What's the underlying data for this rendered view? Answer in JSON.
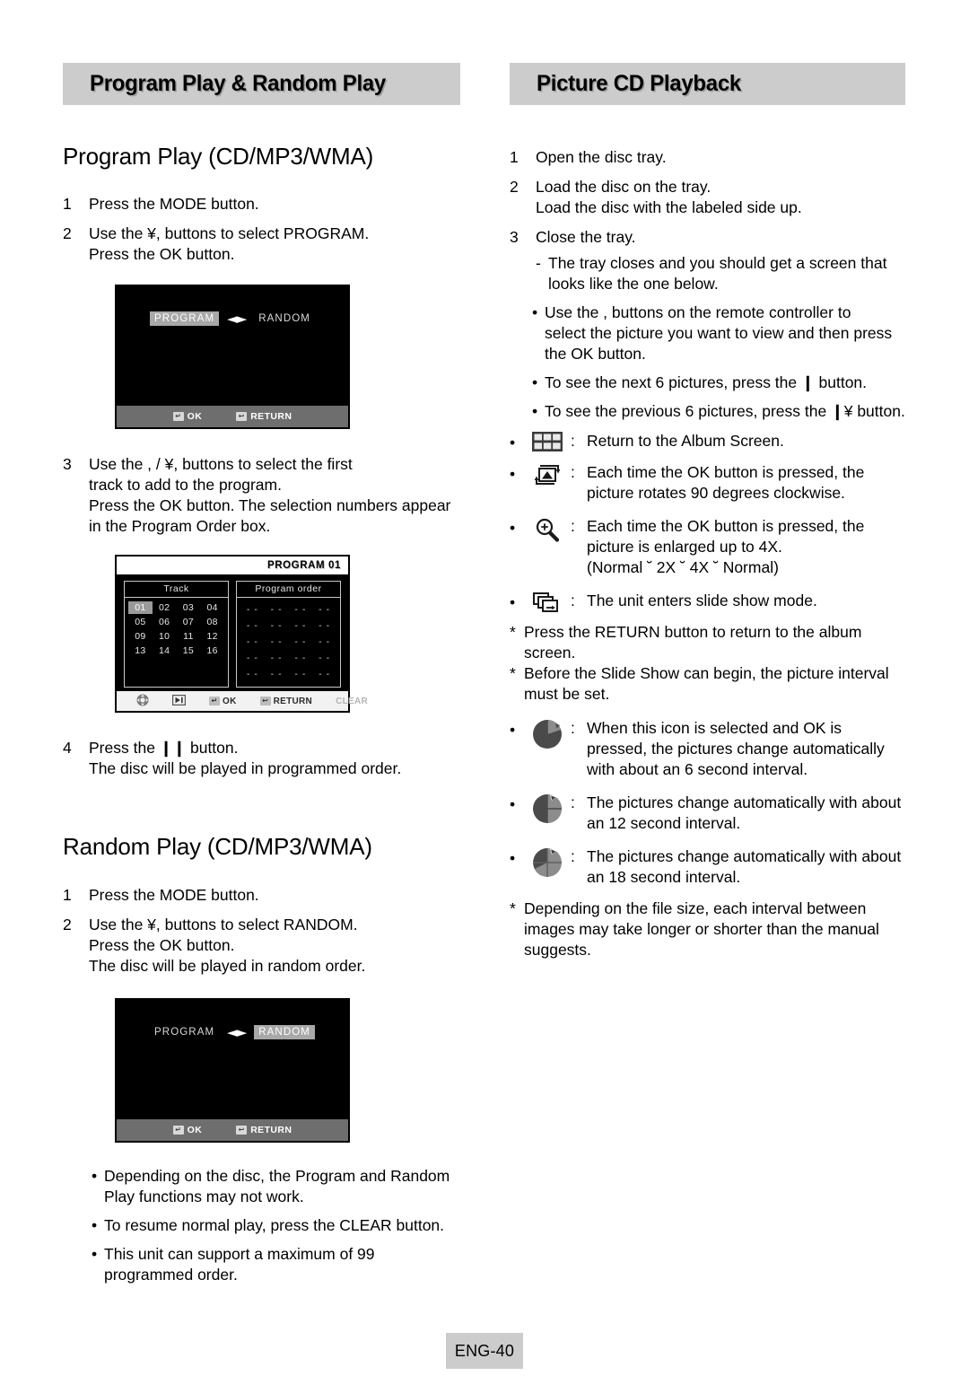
{
  "left": {
    "section_title": "Program Play & Random Play",
    "program": {
      "heading": "Program Play (CD/MP3/WMA)",
      "steps": [
        {
          "num": "1",
          "lines": [
            "Press the MODE button."
          ]
        },
        {
          "num": "2",
          "lines": [
            "Use the ¥,    buttons to select PROGRAM.",
            "Press the OK button."
          ]
        }
      ],
      "steps2": [
        {
          "num": "3",
          "lines": [
            "Use the    ,     / ¥,     buttons to select the first",
            "track to add to the program.",
            "Press the OK button. The selection numbers appear",
            "in the Program Order box."
          ]
        }
      ],
      "steps3": [
        {
          "num": "4",
          "lines": [
            "Press the     ❙❙ button.",
            "The disc will be played in programmed order."
          ]
        }
      ]
    },
    "osd1": {
      "program_label": "PROGRAM",
      "random_label": "RANDOM",
      "selected": "PROGRAM",
      "ok_label": "OK",
      "return_label": "RETURN",
      "ok_keycap": "↵",
      "return_keycap": "↩"
    },
    "prog_table": {
      "title": "PROGRAM 01",
      "track_header": "Track",
      "order_header": "Program  order",
      "tracks": [
        "01",
        "02",
        "03",
        "04",
        "05",
        "06",
        "07",
        "08",
        "09",
        "10",
        "11",
        "12",
        "13",
        "14",
        "15",
        "16"
      ],
      "selected_track": "01",
      "order_placeholder": "- -",
      "order_rows": 5,
      "order_cols": 4,
      "footer": {
        "ok_label": "OK",
        "return_label": "RETURN",
        "clear_label": "CLEAR",
        "dpad_icon": "dpad-icon",
        "play_icon": "play-icon",
        "ok_keycap": "↵",
        "return_keycap": "↩"
      }
    },
    "random": {
      "heading": "Random Play (CD/MP3/WMA)",
      "steps": [
        {
          "num": "1",
          "lines": [
            "Press the MODE button."
          ]
        },
        {
          "num": "2",
          "lines": [
            "Use the ¥,    buttons to select RANDOM.",
            "Press the OK button.",
            " The disc will be played in random order."
          ]
        }
      ]
    },
    "osd2": {
      "program_label": "PROGRAM",
      "random_label": "RANDOM",
      "selected": "RANDOM",
      "ok_label": "OK",
      "return_label": "RETURN",
      "ok_keycap": "↵",
      "return_keycap": "↩"
    },
    "notes": [
      [
        "Depending on the disc, the Program and Random",
        "Play functions may not work."
      ],
      [
        "To resume normal play, press the CLEAR button."
      ],
      [
        "This unit can support a maximum of 99",
        "programmed order."
      ]
    ]
  },
  "right": {
    "section_title": "Picture CD Playback",
    "steps": [
      {
        "num": "1",
        "lines": [
          "Open the disc tray."
        ]
      },
      {
        "num": "2",
        "lines": [
          "Load the disc on the tray.",
          "Load the disc with the labeled side up."
        ]
      },
      {
        "num": "3",
        "lines": [
          "Close the tray."
        ]
      }
    ],
    "dash_note": [
      "The tray closes and you should get a screen that",
      "looks like the one below."
    ],
    "bullets": [
      [
        "Use the      ,      buttons on the remote controller to",
        "select the picture you want to view and then press",
        "the OK button."
      ],
      [
        "To see the next 6 pictures, press the      ❙ button."
      ],
      [
        "To see the previous 6 pictures, press the ❙¥    button."
      ]
    ],
    "icon_bullets": [
      {
        "icon": "album-grid-icon",
        "colon": ":",
        "lines": [
          "Return to the Album Screen."
        ]
      },
      {
        "icon": "rotate-picture-icon",
        "colon": ":",
        "lines": [
          "Each time the OK button is pressed, the",
          "picture rotates 90 degrees clockwise."
        ]
      },
      {
        "icon": "zoom-magnifier-icon",
        "colon": ":",
        "lines": [
          "Each time the OK button is pressed, the",
          "picture is enlarged up to 4X.",
          "(Normal ˘ 2X ˘ 4X ˘ Normal)"
        ]
      },
      {
        "icon": "slide-show-icon",
        "colon": ":",
        "lines": [
          "The unit enters slide show mode."
        ]
      }
    ],
    "star_notes_1": [
      [
        "Press the RETURN button to return to the album screen."
      ],
      [
        "Before the Slide Show can begin, the picture interval",
        "must be set."
      ]
    ],
    "interval_bullets": [
      {
        "icon": "clock-6sec-icon",
        "colon": ":",
        "lines": [
          "When this icon is selected and OK is",
          "pressed, the pictures change automatically",
          "with about an 6 second interval."
        ]
      },
      {
        "icon": "clock-12sec-icon",
        "colon": ":",
        "lines": [
          "The pictures change automatically with about",
          "an 12 second interval."
        ]
      },
      {
        "icon": "clock-18sec-icon",
        "colon": ":",
        "lines": [
          "The pictures change automatically with about",
          "an 18 second interval."
        ]
      }
    ],
    "star_notes_2": [
      [
        "Depending on the file size, each interval between",
        "images may take longer or shorter than the manual",
        "suggests."
      ]
    ]
  },
  "footer": {
    "page_label": "ENG-40"
  },
  "colors": {
    "header_bg": "#cccccc",
    "osd_bg": "#000000",
    "highlight": "#a8a8a8"
  }
}
